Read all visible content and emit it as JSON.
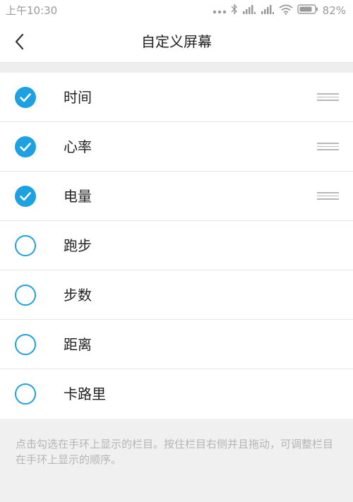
{
  "status_bar": {
    "time": "上午10:30",
    "battery_percent": "82%",
    "icons": [
      "dots-icon",
      "bluetooth-icon",
      "signal-icon",
      "signal-icon",
      "wifi-icon",
      "battery-icon"
    ]
  },
  "header": {
    "title": "自定义屏幕",
    "back_icon": "chevron-left-icon"
  },
  "items": [
    {
      "label": "时间",
      "checked": true,
      "draggable": true
    },
    {
      "label": "心率",
      "checked": true,
      "draggable": true
    },
    {
      "label": "电量",
      "checked": true,
      "draggable": true
    },
    {
      "label": "跑步",
      "checked": false,
      "draggable": false
    },
    {
      "label": "步数",
      "checked": false,
      "draggable": false
    },
    {
      "label": "距离",
      "checked": false,
      "draggable": false
    },
    {
      "label": "卡路里",
      "checked": false,
      "draggable": false
    }
  ],
  "footer": {
    "hint": "点击勾选在手环上显示的栏目。按住栏目右侧并且拖动，可调整栏目在手环上显示的顺序。"
  },
  "colors": {
    "accent": "#1da1e2",
    "text": "#222222",
    "hint_text": "#b5b5b5",
    "status_text": "#9a9a9a"
  }
}
